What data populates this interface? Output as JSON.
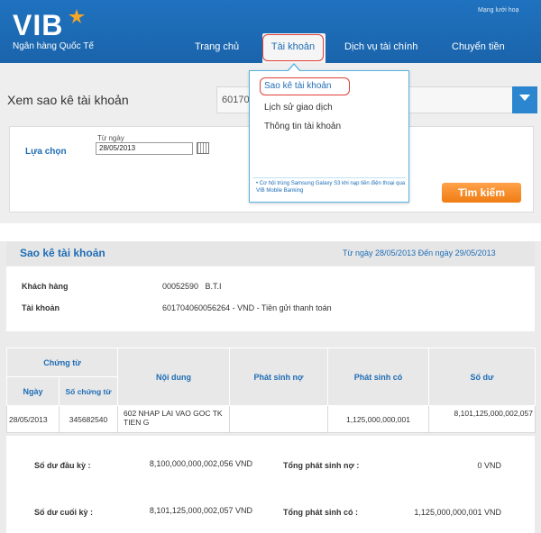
{
  "header": {
    "logo": "VIB",
    "bank_name": "Ngân hàng Quốc Tế",
    "top_link": "Mạng lưới hoạ",
    "nav": {
      "home": "Trang chủ",
      "account": "Tài khoản",
      "services": "Dịch vụ tài chính",
      "transfer": "Chuyển tiền"
    }
  },
  "dropdown": {
    "items": [
      "Sao kê tài khoản",
      "Lịch sử giao dịch",
      "Thông tin tài khoản"
    ],
    "promo": "• Cơ hội trúng Samsung Galaxy S3 khi nạp tiền điện thoại qua VIB Mobile Banking"
  },
  "panel": {
    "title": "Xem sao kê tài khoản",
    "account_select_value": "60170",
    "filter_label": "Lựa chọn",
    "from_date_label": "Từ ngày",
    "from_date_value": "28/05/2013",
    "search_button": "Tìm kiếm"
  },
  "statement": {
    "title": "Sao kê tài khoản",
    "range": "Từ ngày 28/05/2013 Đến ngày 29/05/2013",
    "customer_label": "Khách hàng",
    "customer_value": "00052590   B.T.I",
    "account_label": "Tài khoản",
    "account_value": "601704060056264 - VND - Tiền gửi thanh toán"
  },
  "table": {
    "headers": {
      "voucher": "Chứng từ",
      "date": "Ngày",
      "voucher_no": "Số chứng từ",
      "content": "Nội dung",
      "debit": "Phát sinh nợ",
      "credit": "Phát sinh có",
      "balance": "Số dư"
    },
    "rows": [
      {
        "date": "28/05/2013",
        "voucher_no": "345682540",
        "content": "602 NHAP LAI VAO GOC TK TIEN G",
        "debit": "",
        "credit": "1,125,000,000,001",
        "balance": "8,101,125,000,002,057"
      }
    ]
  },
  "summary": {
    "opening_label": "Số dư đầu kỳ :",
    "opening_value": "8,100,000,000,002,056 VND",
    "total_debit_label": "Tổng phát sinh nợ :",
    "total_debit_value": "0 VND",
    "closing_label": "Số dư cuối kỳ :",
    "closing_value": "8,101,125,000,002,057 VND",
    "total_credit_label": "Tổng phát sinh có :",
    "total_credit_value": "1,125,000,000,001 VND"
  },
  "colors": {
    "brand_blue": "#1f6db5",
    "header_blue": "#1f72bf",
    "accent_orange": "#f07c12",
    "highlight_red": "#e0403a"
  }
}
